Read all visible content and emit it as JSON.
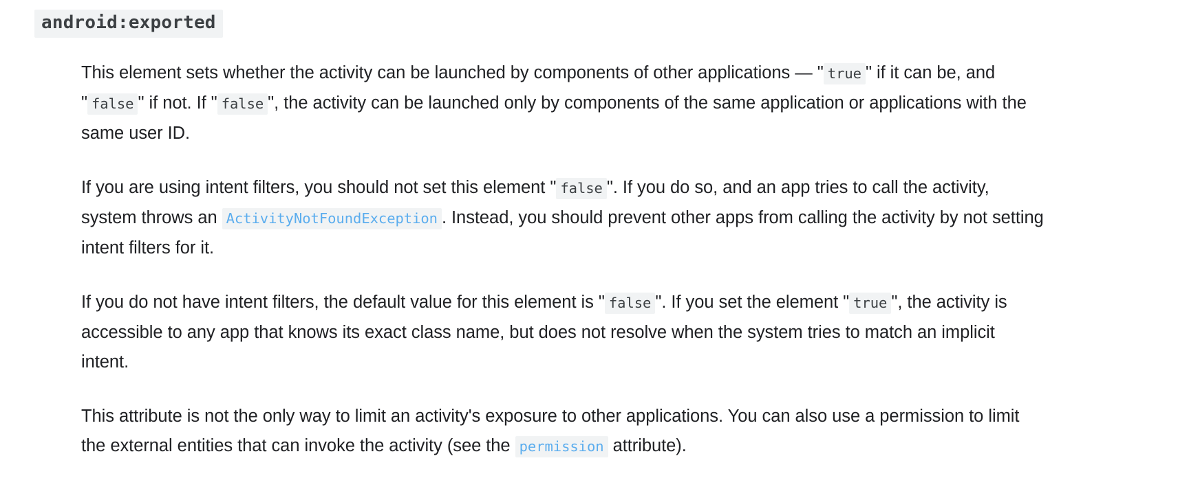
{
  "heading": {
    "text": "android:exported"
  },
  "colors": {
    "page_background": "#ffffff",
    "body_text": "#202124",
    "code_background": "#f1f3f4",
    "code_text": "#3c4043",
    "code_link_text": "#5badee"
  },
  "paragraphs": [
    {
      "id": "paragraph-1",
      "parts": [
        {
          "type": "text",
          "value": "This element sets whether the activity can be launched by components of other applications — \""
        },
        {
          "type": "code",
          "value": "true"
        },
        {
          "type": "text",
          "value": "\" if it can be, and \""
        },
        {
          "type": "code",
          "value": "false"
        },
        {
          "type": "text",
          "value": "\" if not. If \""
        },
        {
          "type": "code",
          "value": "false"
        },
        {
          "type": "text",
          "value": "\", the activity can be launched only by components of the same application or applications with the same user ID."
        }
      ]
    },
    {
      "id": "paragraph-2",
      "parts": [
        {
          "type": "text",
          "value": "If you are using intent filters, you should not set this element \""
        },
        {
          "type": "code",
          "value": "false"
        },
        {
          "type": "text",
          "value": "\". If you do so, and an app tries to call the activity, system throws an "
        },
        {
          "type": "code-link",
          "value": "ActivityNotFoundException"
        },
        {
          "type": "text",
          "value": ". Instead, you should prevent other apps from calling the activity by not setting intent filters for it."
        }
      ]
    },
    {
      "id": "paragraph-3",
      "parts": [
        {
          "type": "text",
          "value": "If you do not have intent filters, the default value for this element is \""
        },
        {
          "type": "code",
          "value": "false"
        },
        {
          "type": "text",
          "value": "\". If you set the element \""
        },
        {
          "type": "code",
          "value": "true"
        },
        {
          "type": "text",
          "value": "\", the activity is accessible to any app that knows its exact class name, but does not resolve when the system tries to match an implicit intent."
        }
      ]
    },
    {
      "id": "paragraph-4",
      "parts": [
        {
          "type": "text",
          "value": "This attribute is not the only way to limit an activity's exposure to other applications. You can also use a permission to limit the external entities that can invoke the activity (see the "
        },
        {
          "type": "code-link",
          "value": "permission"
        },
        {
          "type": "text",
          "value": " attribute)."
        }
      ]
    }
  ]
}
